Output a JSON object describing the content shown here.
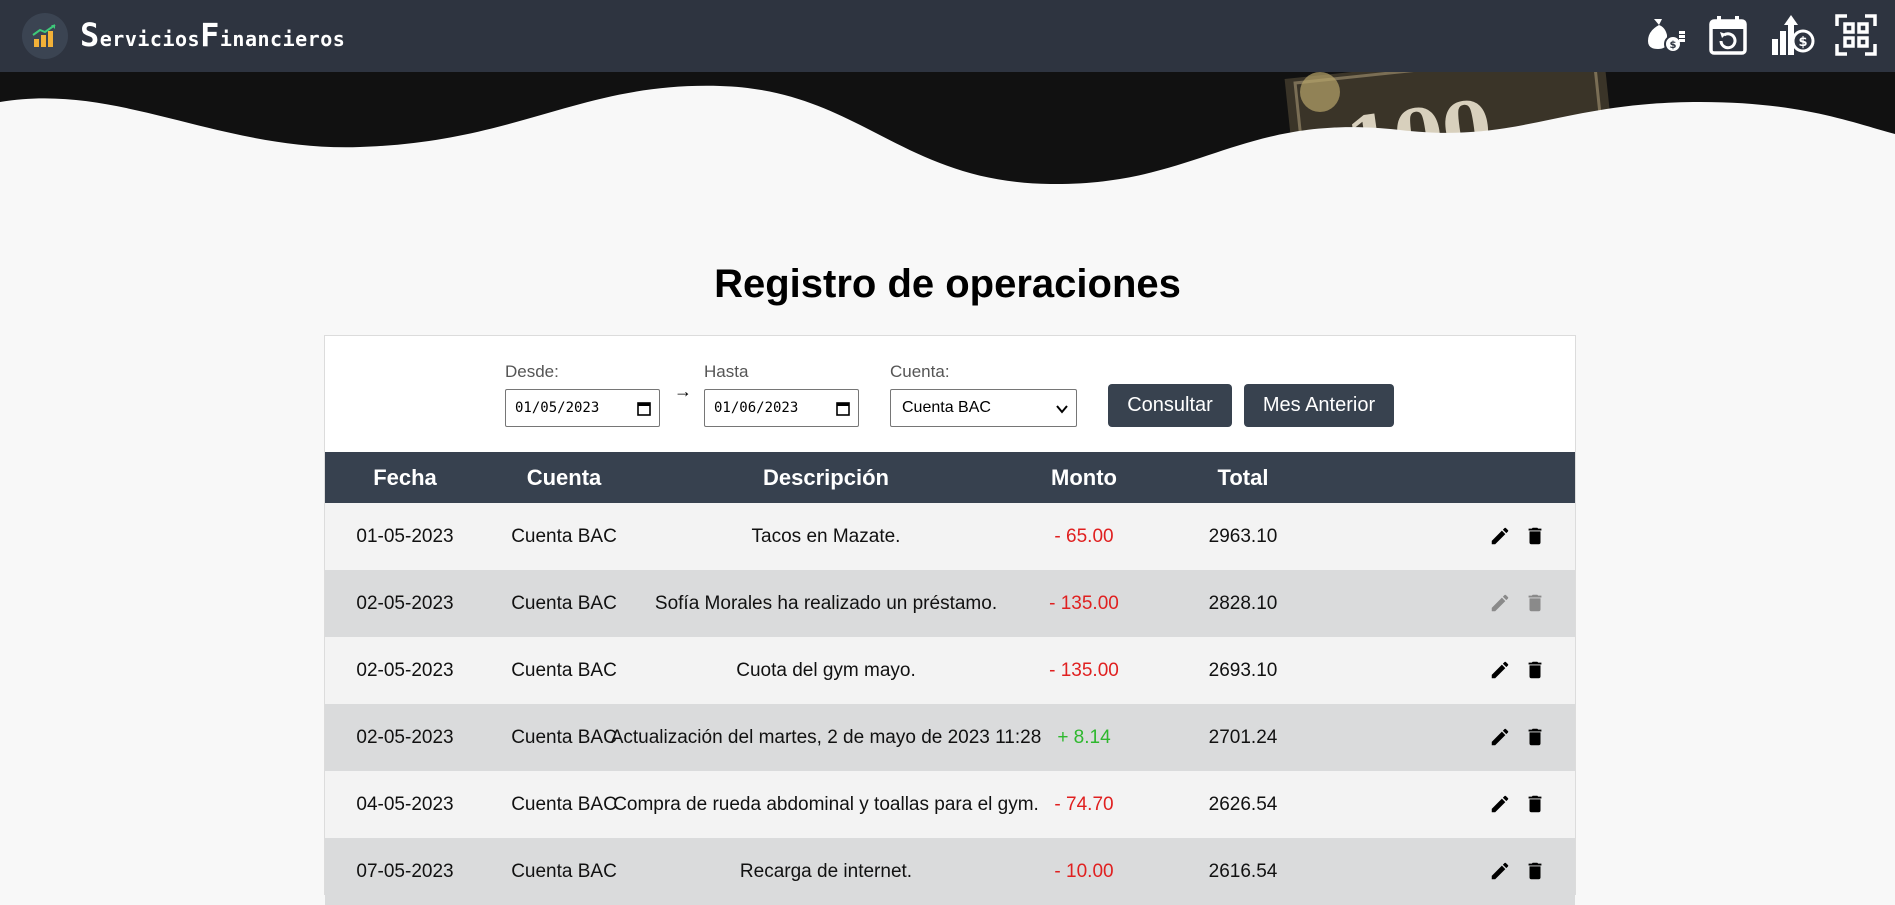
{
  "brand": {
    "first_cap": "S",
    "first_rest": "ervicios",
    "second_cap": "F",
    "second_rest": "inancieros"
  },
  "nav_icons": [
    "money-bag-icon",
    "calendar-refresh-icon",
    "growth-dollar-icon",
    "qr-scan-icon"
  ],
  "page_title": "Registro de operaciones",
  "filter": {
    "desde_label": "Desde:",
    "desde_value": "01/05/2023",
    "hasta_label": "Hasta",
    "hasta_value": "01/06/2023",
    "arrow": "→",
    "cuenta_label": "Cuenta:",
    "cuenta_value": "Cuenta BAC",
    "consultar": "Consultar",
    "mes_anterior": "Mes Anterior"
  },
  "table": {
    "headers": {
      "fecha": "Fecha",
      "cuenta": "Cuenta",
      "descripcion": "Descripción",
      "monto": "Monto",
      "total": "Total"
    },
    "rows": [
      {
        "fecha": "01-05-2023",
        "cuenta": "Cuenta BAC",
        "descripcion": "Tacos en Mazate.",
        "monto": "- 65.00",
        "total": "2963.10",
        "sign": "neg",
        "disabled": false
      },
      {
        "fecha": "02-05-2023",
        "cuenta": "Cuenta BAC",
        "descripcion": "Sofía Morales ha realizado un préstamo.",
        "monto": "- 135.00",
        "total": "2828.10",
        "sign": "neg",
        "disabled": true
      },
      {
        "fecha": "02-05-2023",
        "cuenta": "Cuenta BAC",
        "descripcion": "Cuota del gym mayo.",
        "monto": "- 135.00",
        "total": "2693.10",
        "sign": "neg",
        "disabled": false
      },
      {
        "fecha": "02-05-2023",
        "cuenta": "Cuenta BAC",
        "descripcion": "Actualización del martes, 2 de mayo de 2023 11:28",
        "monto": "+ 8.14",
        "total": "2701.24",
        "sign": "pos",
        "disabled": false
      },
      {
        "fecha": "04-05-2023",
        "cuenta": "Cuenta BAC",
        "descripcion": "Compra de rueda abdominal y toallas para el gym.",
        "monto": "- 74.70",
        "total": "2626.54",
        "sign": "neg",
        "disabled": false
      },
      {
        "fecha": "07-05-2023",
        "cuenta": "Cuenta BAC",
        "descripcion": "Recarga de internet.",
        "monto": "- 10.00",
        "total": "2616.54",
        "sign": "neg",
        "disabled": false
      }
    ]
  },
  "colors": {
    "navbar": "#2e3440",
    "header": "#37414f",
    "negative": "#e02020",
    "positive": "#2eb82e",
    "disabled_icon": "#8a8a8a"
  }
}
